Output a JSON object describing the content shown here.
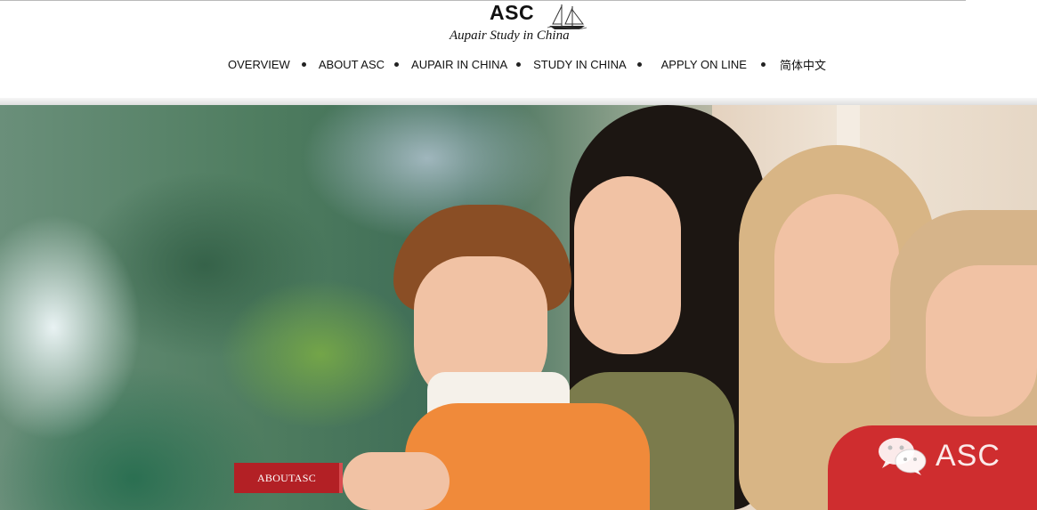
{
  "header": {
    "logo_word": "ASC",
    "logo_tagline": "Aupair Study in China"
  },
  "nav": {
    "items": [
      {
        "label": "OVERVIEW"
      },
      {
        "label": "ABOUT ASC"
      },
      {
        "label": "AUPAIR IN CHINA"
      },
      {
        "label": "STUDY IN CHINA"
      },
      {
        "label": "APPLY ON LINE"
      },
      {
        "label": "简体中文"
      }
    ]
  },
  "hero": {
    "badge_label": "ABOUTASC",
    "watermark_label": "ASC",
    "watermark_icon": "wechat-icon",
    "badge_color": "#b32025"
  }
}
